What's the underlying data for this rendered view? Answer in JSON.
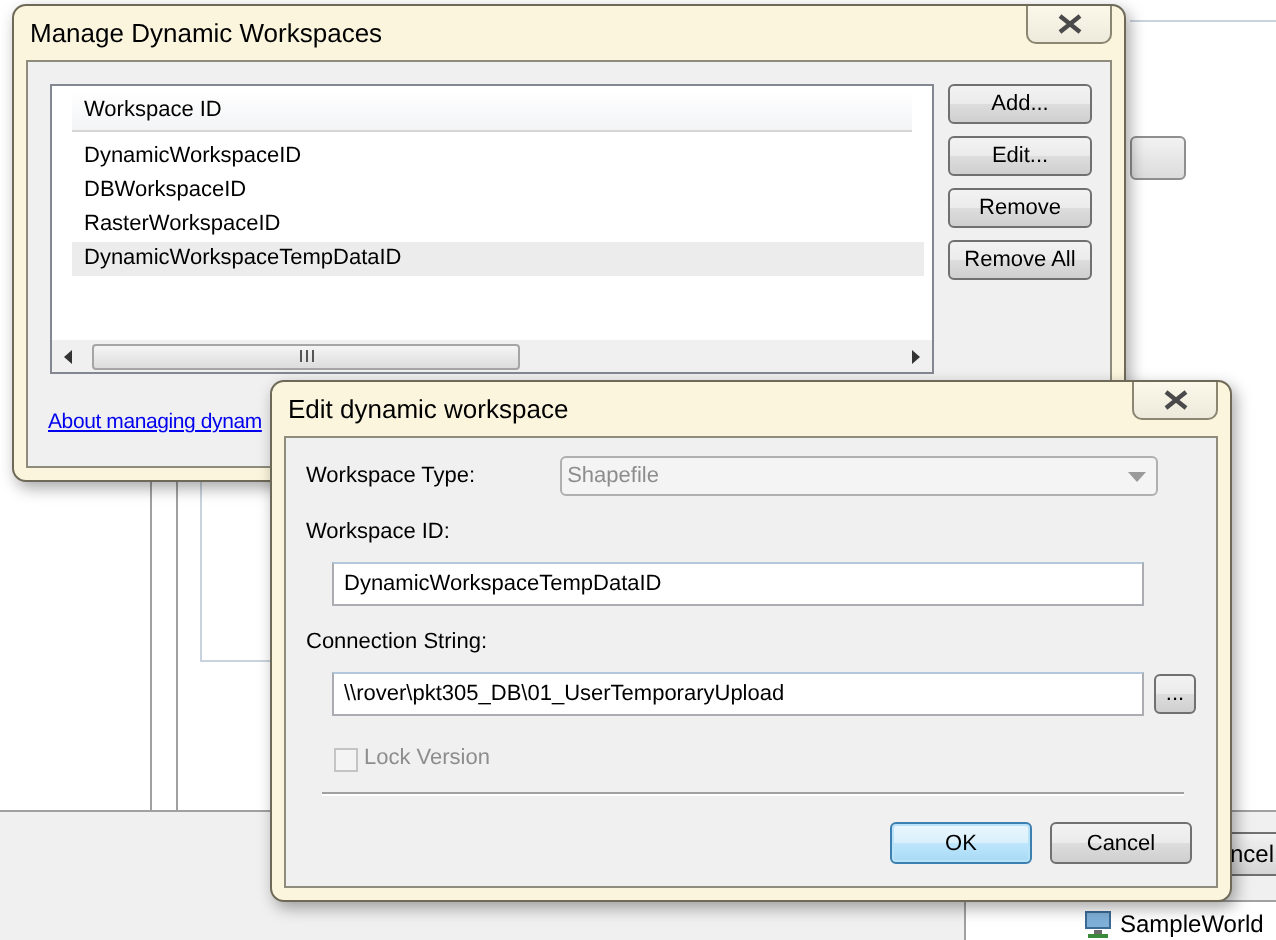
{
  "background": {
    "button_text": "ncel",
    "tree_item": "SampleWorld"
  },
  "manage_dialog": {
    "title": "Manage Dynamic Workspaces",
    "list": {
      "columns": [
        "Workspace ID"
      ],
      "rows": [
        {
          "id": "DynamicWorkspaceID",
          "selected": false
        },
        {
          "id": "DBWorkspaceID",
          "selected": false
        },
        {
          "id": "RasterWorkspaceID",
          "selected": false
        },
        {
          "id": "DynamicWorkspaceTempDataID",
          "selected": true
        }
      ]
    },
    "buttons": [
      "Add...",
      "Edit...",
      "Remove",
      "Remove All"
    ],
    "help_link": "About managing dynam"
  },
  "edit_dialog": {
    "title": "Edit dynamic workspace",
    "fields": [
      {
        "kind": "combo",
        "label": "Workspace Type:",
        "value": "Shapefile",
        "disabled": true
      },
      {
        "kind": "text",
        "label": "Workspace ID:",
        "value": "DynamicWorkspaceTempDataID",
        "disabled": false
      },
      {
        "kind": "browse",
        "label": "Connection String:",
        "value": "\\\\rover\\pkt305_DB\\01_UserTemporaryUpload",
        "button": "...",
        "disabled": false
      }
    ],
    "lock_version": {
      "label": "Lock Version",
      "checked": false,
      "disabled": true
    },
    "buttons": [
      {
        "label": "OK",
        "default": true
      },
      {
        "label": "Cancel",
        "default": false
      }
    ]
  }
}
